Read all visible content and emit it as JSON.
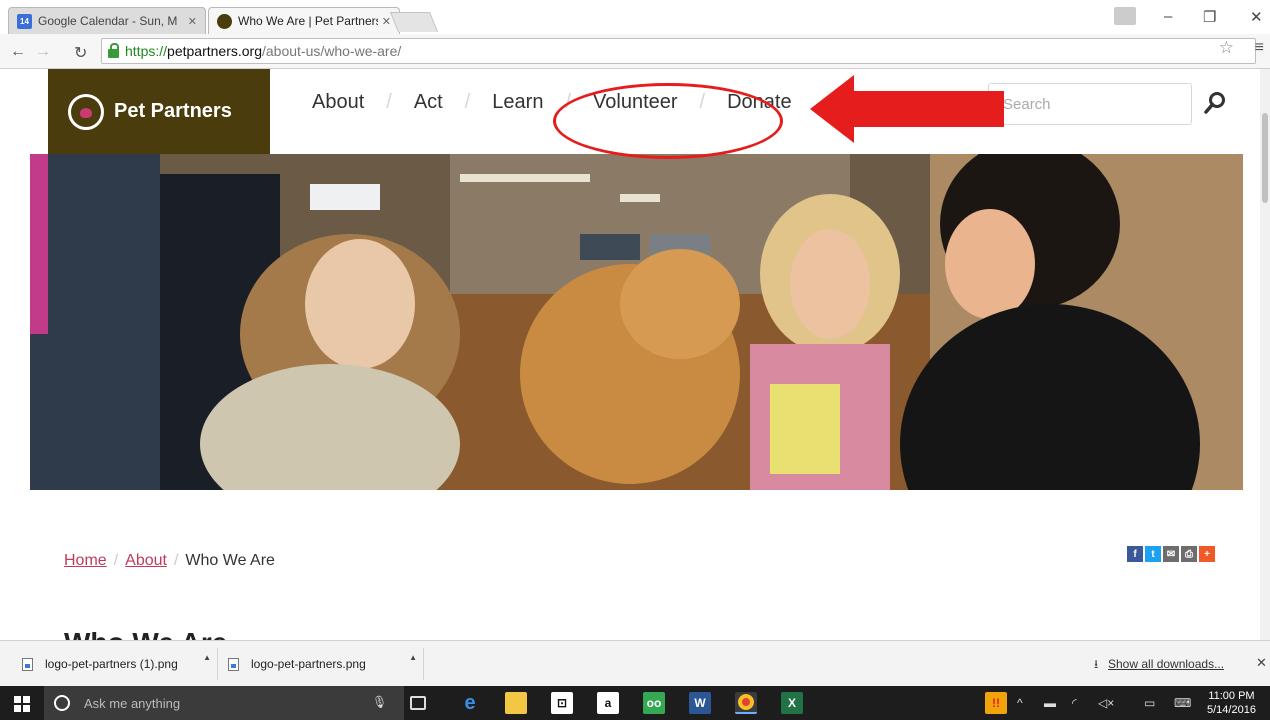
{
  "browser": {
    "tabs": [
      {
        "title": "Google Calendar - Sun, M",
        "favicon_text": "14",
        "favicon_color": "#3a6fd8"
      },
      {
        "title": "Who We Are | Pet Partners",
        "favicon_color": "#4a3c0c"
      }
    ],
    "url": {
      "scheme": "https://",
      "host": "petpartners.org",
      "path": "/about-us/who-we-are/"
    }
  },
  "site": {
    "logo_text": "Pet Partners",
    "nav": [
      "About",
      "Act",
      "Learn",
      "Volunteer",
      "Donate"
    ],
    "nav_separator": "/",
    "search_placeholder": "Search",
    "brand_color": "#4a3c0c",
    "accent_color": "#c23b5c"
  },
  "breadcrumb": {
    "home": "Home",
    "about": "About",
    "current": "Who We Are",
    "separator": "/"
  },
  "share_icons": [
    {
      "name": "facebook-icon",
      "label": "f",
      "color": "#3b5998"
    },
    {
      "name": "twitter-icon",
      "label": "t",
      "color": "#1da1f2"
    },
    {
      "name": "email-icon",
      "label": "✉",
      "color": "#6d6d6d"
    },
    {
      "name": "print-icon",
      "label": "⎙",
      "color": "#6d6d6d"
    },
    {
      "name": "more-icon",
      "label": "+",
      "color": "#f05a28"
    }
  ],
  "page_heading": "Who We Are",
  "downloads": {
    "items": [
      "logo-pet-partners (1).png",
      "logo-pet-partners.png"
    ],
    "show_all": "Show all downloads..."
  },
  "taskbar": {
    "search_placeholder": "Ask me anything",
    "time": "11:00 PM",
    "date": "5/14/2016"
  },
  "annotation_color": "#e61d1d"
}
